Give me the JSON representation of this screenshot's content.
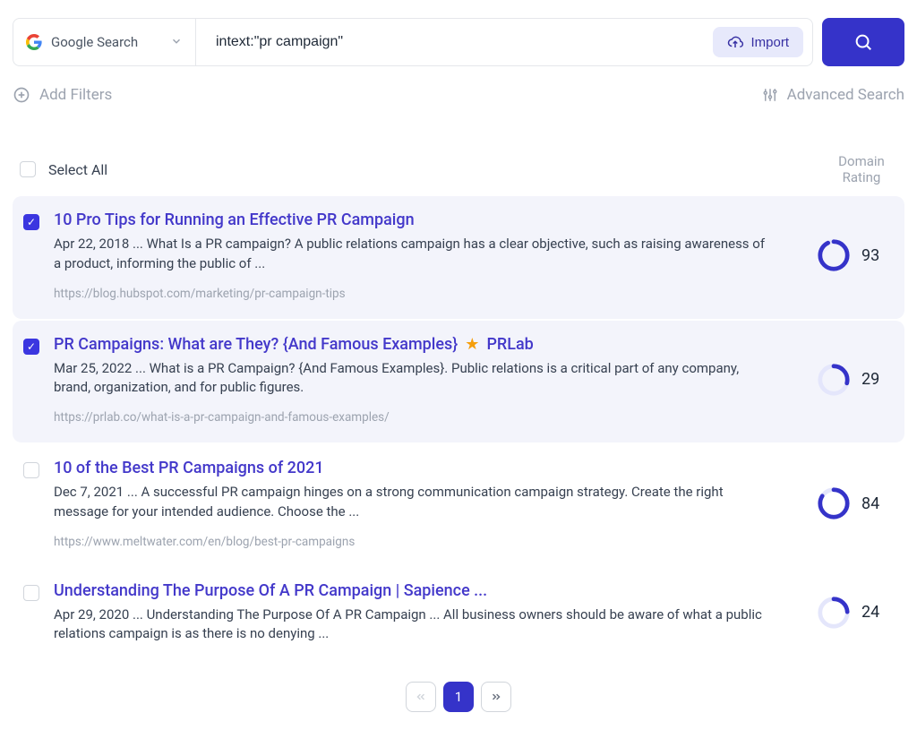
{
  "search": {
    "source_label": "Google Search",
    "query": "intext:\"pr campaign\"",
    "import_label": "Import"
  },
  "filters": {
    "add_label": "Add Filters",
    "advanced_label": "Advanced Search"
  },
  "header": {
    "select_all_label": "Select All",
    "domain_rating_label_1": "Domain",
    "domain_rating_label_2": "Rating"
  },
  "results": [
    {
      "selected": true,
      "title": "10 Pro Tips for Running an Effective PR Campaign",
      "starred": false,
      "title_suffix": "",
      "snippet": "Apr 22, 2018 ... What Is a PR campaign? A public relations campaign has a clear objective, such as raising awareness of a product, informing the public of ...",
      "url": "https://blog.hubspot.com/marketing/pr-campaign-tips",
      "rating": 93,
      "ring_track": "#e4e6fb",
      "ring_color": "#3533c9"
    },
    {
      "selected": true,
      "title": "PR Campaigns: What are They? {And Famous Examples}",
      "starred": true,
      "title_suffix": "PRLab",
      "snippet": "Mar 25, 2022 ... What is a PR Campaign? {And Famous Examples}. Public relations is a critical part of any company, brand, organization, and for public figures.",
      "url": "https://prlab.co/what-is-a-pr-campaign-and-famous-examples/",
      "rating": 29,
      "ring_track": "#e4e6fb",
      "ring_color": "#3533c9"
    },
    {
      "selected": false,
      "title": "10 of the Best PR Campaigns of 2021",
      "starred": false,
      "title_suffix": "",
      "snippet": "Dec 7, 2021 ... A successful PR campaign hinges on a strong communication campaign strategy. Create the right message for your intended audience. Choose the ...",
      "url": "https://www.meltwater.com/en/blog/best-pr-campaigns",
      "rating": 84,
      "ring_track": "#e4e6fb",
      "ring_color": "#3533c9"
    },
    {
      "selected": false,
      "title": "Understanding The Purpose Of A PR Campaign | Sapience ...",
      "starred": false,
      "title_suffix": "",
      "snippet": "Apr 29, 2020 ... Understanding The Purpose Of A PR Campaign ... All business owners should be aware of what a public relations campaign is as there is no denying ...",
      "url": "",
      "rating": 24,
      "ring_track": "#e4e6fb",
      "ring_color": "#3533c9"
    }
  ],
  "pager": {
    "current": "1"
  }
}
